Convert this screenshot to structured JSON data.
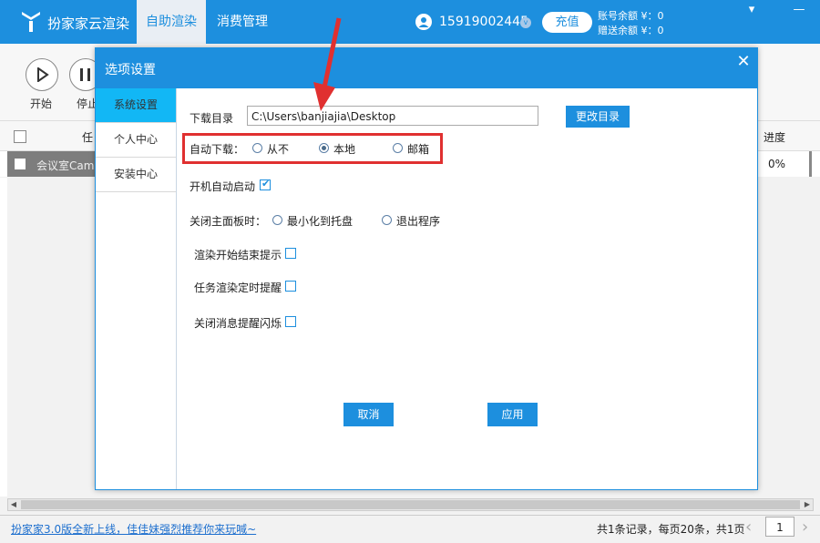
{
  "header": {
    "app_title": "扮家家云渲染",
    "tabs": [
      {
        "label": "自助渲染",
        "active": true
      },
      {
        "label": "消费管理",
        "active": false
      }
    ],
    "phone": "15919002445",
    "v_badge": "v",
    "recharge_label": "充值",
    "balance_label": "账号余额 ¥：0",
    "gift_balance_label": "赠送余额 ¥：0",
    "minimize_icon": "▾",
    "close_icon": "—"
  },
  "toolbar": {
    "start_label": "开始",
    "pause_label": "停止"
  },
  "table": {
    "header_task": "任",
    "header_progress": "进度",
    "rows": [
      {
        "name": "会议室Came",
        "progress": "0%"
      }
    ]
  },
  "dialog": {
    "title": "选项设置",
    "close_icon": "✕",
    "sidebar": [
      {
        "label": "系统设置",
        "active": true
      },
      {
        "label": "个人中心",
        "active": false
      },
      {
        "label": "安装中心",
        "active": false
      }
    ],
    "download_dir_label": "下载目录",
    "download_dir_value": "C:\\Users\\banjiajia\\Desktop",
    "change_dir_label": "更改目录",
    "auto_download_label": "自动下载：",
    "auto_download_options": [
      {
        "label": "从不",
        "selected": false
      },
      {
        "label": "本地",
        "selected": true
      },
      {
        "label": "邮箱",
        "selected": false
      }
    ],
    "autostart_label": "开机自动启动",
    "autostart_checked": true,
    "close_panel_label": "关闭主面板时：",
    "close_panel_options": [
      {
        "label": "最小化到托盘",
        "selected": false
      },
      {
        "label": "退出程序",
        "selected": false
      }
    ],
    "render_notify_label": "渲染开始结束提示",
    "task_reminder_label": "任务渲染定时提醒",
    "flash_label": "关闭消息提醒闪烁",
    "cancel_label": "取消",
    "apply_label": "应用"
  },
  "footer": {
    "promo_text": "扮家家3.0版全新上线，佳佳妹强烈推荐你来玩喊~",
    "page_info": "共1条记录，每页20条，共1页",
    "page_number": "1",
    "prev_icon": "‹",
    "next_icon": "›"
  },
  "colors": {
    "brand": "#1d8fde",
    "highlight": "#e03030",
    "sidebar_active": "#12b7f5"
  }
}
